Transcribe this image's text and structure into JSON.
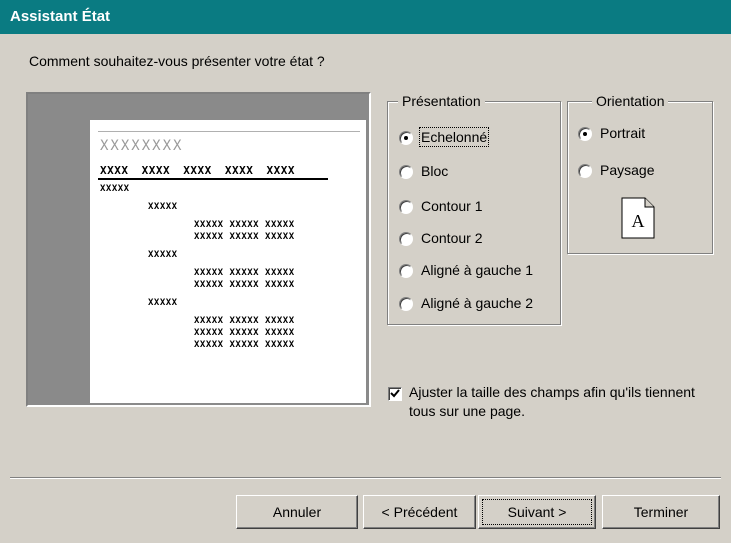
{
  "window": {
    "title": "Assistant État"
  },
  "question": "Comment souhaitez-vous présenter votre état ?",
  "preview": {
    "title": "XXXXXXXX",
    "header": "XXXX XXXX XXXX XXXX XXXX",
    "rows": [
      "XXXXX",
      "XXXXX",
      "XXXXX  XXXXX  XXXXX",
      "XXXXX  XXXXX  XXXXX",
      "XXXXX",
      "XXXXX  XXXXX  XXXXX",
      "XXXXX  XXXXX  XXXXX",
      "XXXXX",
      "XXXXX  XXXXX  XXXXX",
      "XXXXX  XXXXX  XXXXX",
      "XXXXX  XXXXX  XXXXX"
    ]
  },
  "presentation": {
    "legend": "Présentation",
    "options": [
      {
        "label": "Echelonné",
        "selected": true
      },
      {
        "label": "Bloc",
        "selected": false
      },
      {
        "label": "Contour 1",
        "selected": false
      },
      {
        "label": "Contour 2",
        "selected": false
      },
      {
        "label": "Aligné à gauche 1",
        "selected": false
      },
      {
        "label": "Aligné à gauche 2",
        "selected": false
      }
    ]
  },
  "orientation": {
    "legend": "Orientation",
    "options": [
      {
        "label": "Portrait",
        "selected": true
      },
      {
        "label": "Paysage",
        "selected": false
      }
    ],
    "icon": "portrait-page-icon",
    "icon_letter": "A"
  },
  "fit_checkbox": {
    "label": "Ajuster la taille des champs afin qu'ils tiennent tous sur une page.",
    "checked": true
  },
  "buttons": {
    "cancel": "Annuler",
    "previous": "< Précédent",
    "next": "Suivant >",
    "finish": "Terminer"
  },
  "colors": {
    "titlebar": "#0a7b82",
    "face": "#d4d0c8",
    "preview_bg": "#8a8a8a"
  }
}
